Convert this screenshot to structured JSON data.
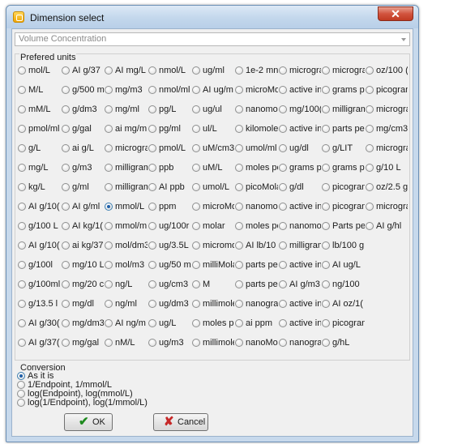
{
  "window": {
    "title": "Dimension select",
    "close_glyph": "✕"
  },
  "quantity_select": {
    "value": "Volume Concentration"
  },
  "units": {
    "label": "Prefered units",
    "columns": [
      [
        "mol/L",
        "M/L",
        "mM/L",
        "pmol/ml",
        "g/L",
        "mg/L",
        "kg/L",
        "AI g/10(",
        "g/100 L",
        "AI g/10(",
        "g/100l",
        "g/100ml",
        "g/13.5 l",
        "AI g/30(",
        "AI g/37("
      ],
      [
        "AI g/37",
        "g/500 m",
        "g/dm3",
        "g/gal",
        "ai g/L",
        "g/m3",
        "g/ml",
        "AI g/ml",
        "AI kg/1(",
        "ai kg/37",
        "mg/10 L",
        "mg/20 c",
        "mg/dl",
        "mg/dm3",
        "mg/gal"
      ],
      [
        "AI mg/L",
        "mg/m3",
        "mg/ml",
        "ai mg/m",
        "micrograr",
        "milligram",
        "milligram",
        "mmol/L",
        "mmol/m",
        "mol/dm3",
        "mol/m3",
        "ng/L",
        "ng/ml",
        "AI ng/m",
        "nM/L"
      ],
      [
        "nmol/L",
        "nmol/ml",
        "pg/L",
        "pg/ml",
        "pmol/L",
        "ppb",
        "AI ppb",
        "ppm",
        "ug/100r",
        "ug/3.5L",
        "ug/50 m",
        "ug/cm3",
        "ug/dm3",
        "ug/L",
        "ug/m3"
      ],
      [
        "ug/ml",
        "AI ug/m",
        "ug/ul",
        "ul/L",
        "uM/cm3",
        "uM/L",
        "umol/L",
        "microMo",
        "molar",
        "micromo",
        "milliMola",
        "M",
        "millimole",
        "moles pe",
        "millimole"
      ],
      [
        "1e-2 mn",
        "microMo",
        "nanomo",
        "kilomole",
        "umol/ml",
        "moles pe",
        "picoMola",
        "nanomo",
        "moles pe",
        "AI lb/10",
        "parts pe",
        "parts pe",
        "nanogra",
        "ai ppm",
        "nanoMo"
      ],
      [
        "micrograr",
        "active in",
        "mg/100(",
        "active in",
        "ug/dl",
        "grams p",
        "g/dl",
        "active in",
        "nanomo",
        "milligram",
        "active in",
        "AI g/m3",
        "active in",
        "active in",
        "nanogra"
      ],
      [
        "micrograr",
        "grams p",
        "milligram",
        "parts pe",
        "g/LIT",
        "grams p",
        "picogran",
        "picogran",
        "Parts pe",
        "lb/100 g",
        "AI ug/L",
        "ng/100",
        "AI oz/1(",
        "picogran",
        "g/hL"
      ],
      [
        "oz/100 (",
        "picogran",
        "micrograr",
        "mg/cm3",
        "micrograr",
        "g/10 L",
        "oz/2.5 g",
        "micrograr",
        "AI g/hl",
        "",
        "",
        "",
        "",
        "",
        ""
      ]
    ],
    "selected": "mmol/L"
  },
  "conversion": {
    "label": "Conversion",
    "options": [
      "As it is",
      "1/Endpoint, 1/mmol/L",
      "log(Endpoint), log(mmol/L)",
      "log(1/Endpoint), log(1/mmol/L)"
    ],
    "selected": "As it is"
  },
  "buttons": {
    "ok": {
      "label": "OK",
      "icon": "check-icon",
      "color": "#1e8a1e"
    },
    "cancel": {
      "label": "Cancel",
      "icon": "x-icon",
      "color": "#c62828"
    }
  },
  "colors": {
    "titlebar": "#c3d7ec",
    "dialog_bg": "#f0f0f0",
    "close_button": "#c9452d"
  }
}
